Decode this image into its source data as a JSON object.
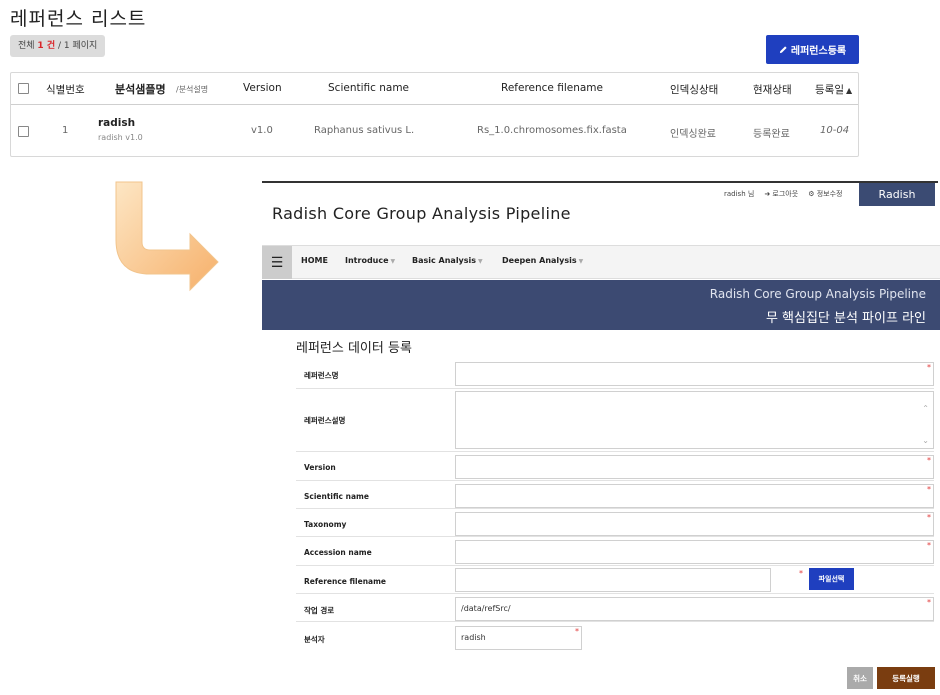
{
  "list": {
    "title": "레퍼런스 리스트",
    "count": {
      "prefix": "전체 ",
      "total": "1 건",
      "suffix": " / 1 페이지"
    },
    "register_button": "레퍼런스등록",
    "columns": {
      "id": "식별번호",
      "name": "분석샘플명",
      "name_sub": "/분석설명",
      "version": "Version",
      "scientific": "Scientific name",
      "filename": "Reference filename",
      "index": "인덱싱상태",
      "status": "현재상태",
      "date": "등록일"
    },
    "rows": [
      {
        "id": "1",
        "name": "radish",
        "desc": "radish v1.0",
        "version": "v1.0",
        "scientific": "Raphanus sativus L.",
        "filename": "Rs_1.0.chromosomes.fix.fasta",
        "index": "인덱싱완료",
        "status": "등록완료",
        "date": "10-04"
      }
    ]
  },
  "app": {
    "user": "radish 님",
    "logout": "로그아웃",
    "profile": "정보수정",
    "tab": "Radish",
    "title": "Radish Core Group Analysis Pipeline",
    "nav": [
      "HOME",
      "Introduce",
      "Basic Analysis",
      "Deepen Analysis"
    ],
    "banner_en": "Radish Core Group Analysis Pipeline",
    "banner_ko": "무 핵심집단 분석 파이프 라인"
  },
  "form": {
    "title": "레퍼런스 데이터 등록",
    "fields": {
      "ref_name": "레퍼런스명",
      "ref_desc": "레퍼런스설명",
      "version": "Version",
      "scientific": "Scientific name",
      "taxonomy": "Taxonomy",
      "accession": "Accession name",
      "filename": "Reference filename",
      "workpath": "작업 경로",
      "analyst": "분석자"
    },
    "file_button": "파일선택",
    "workpath_value": "/data/refSrc/",
    "analyst_value": "radish",
    "cancel": "취소",
    "submit": "등록실행"
  },
  "colors": {
    "primary_button": "#1f3fbf",
    "banner": "#3c4a72",
    "submit": "#7a3d10",
    "required": "#e23b3b"
  }
}
